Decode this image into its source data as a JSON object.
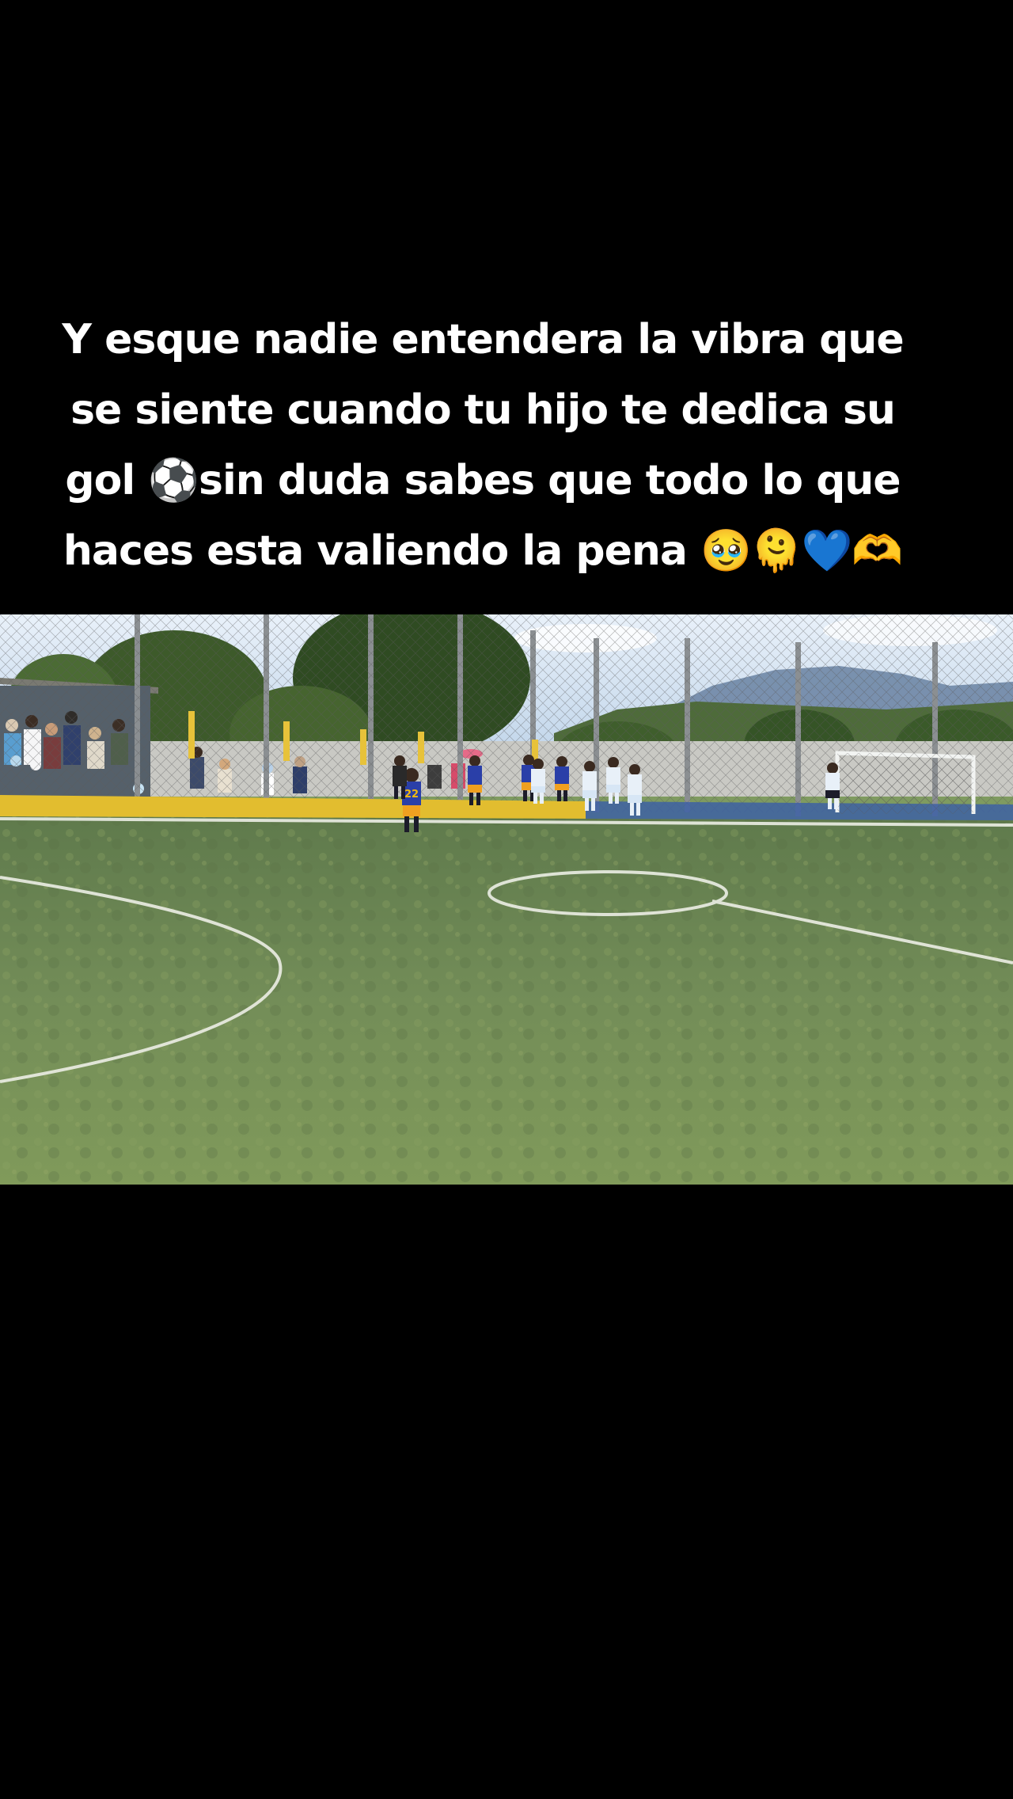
{
  "caption": {
    "lines": [
      "Y esque nadie entendera la vibra que",
      "se siente cuando tu hijo te dedica su",
      "gol ⚽sin duda sabes que todo lo que",
      "haces  esta valiendo la pena 🥹🫠💙🫶"
    ]
  },
  "video": {
    "jersey_number": "22"
  },
  "colors": {
    "background": "#000000",
    "caption_text": "#ffffff",
    "pitch": "#6f8a55",
    "sky": "#cfe0f0",
    "wall_yellow": "#e7c23a",
    "team_blue": "#2a3fa8",
    "team_white": "#e8f0f8"
  }
}
